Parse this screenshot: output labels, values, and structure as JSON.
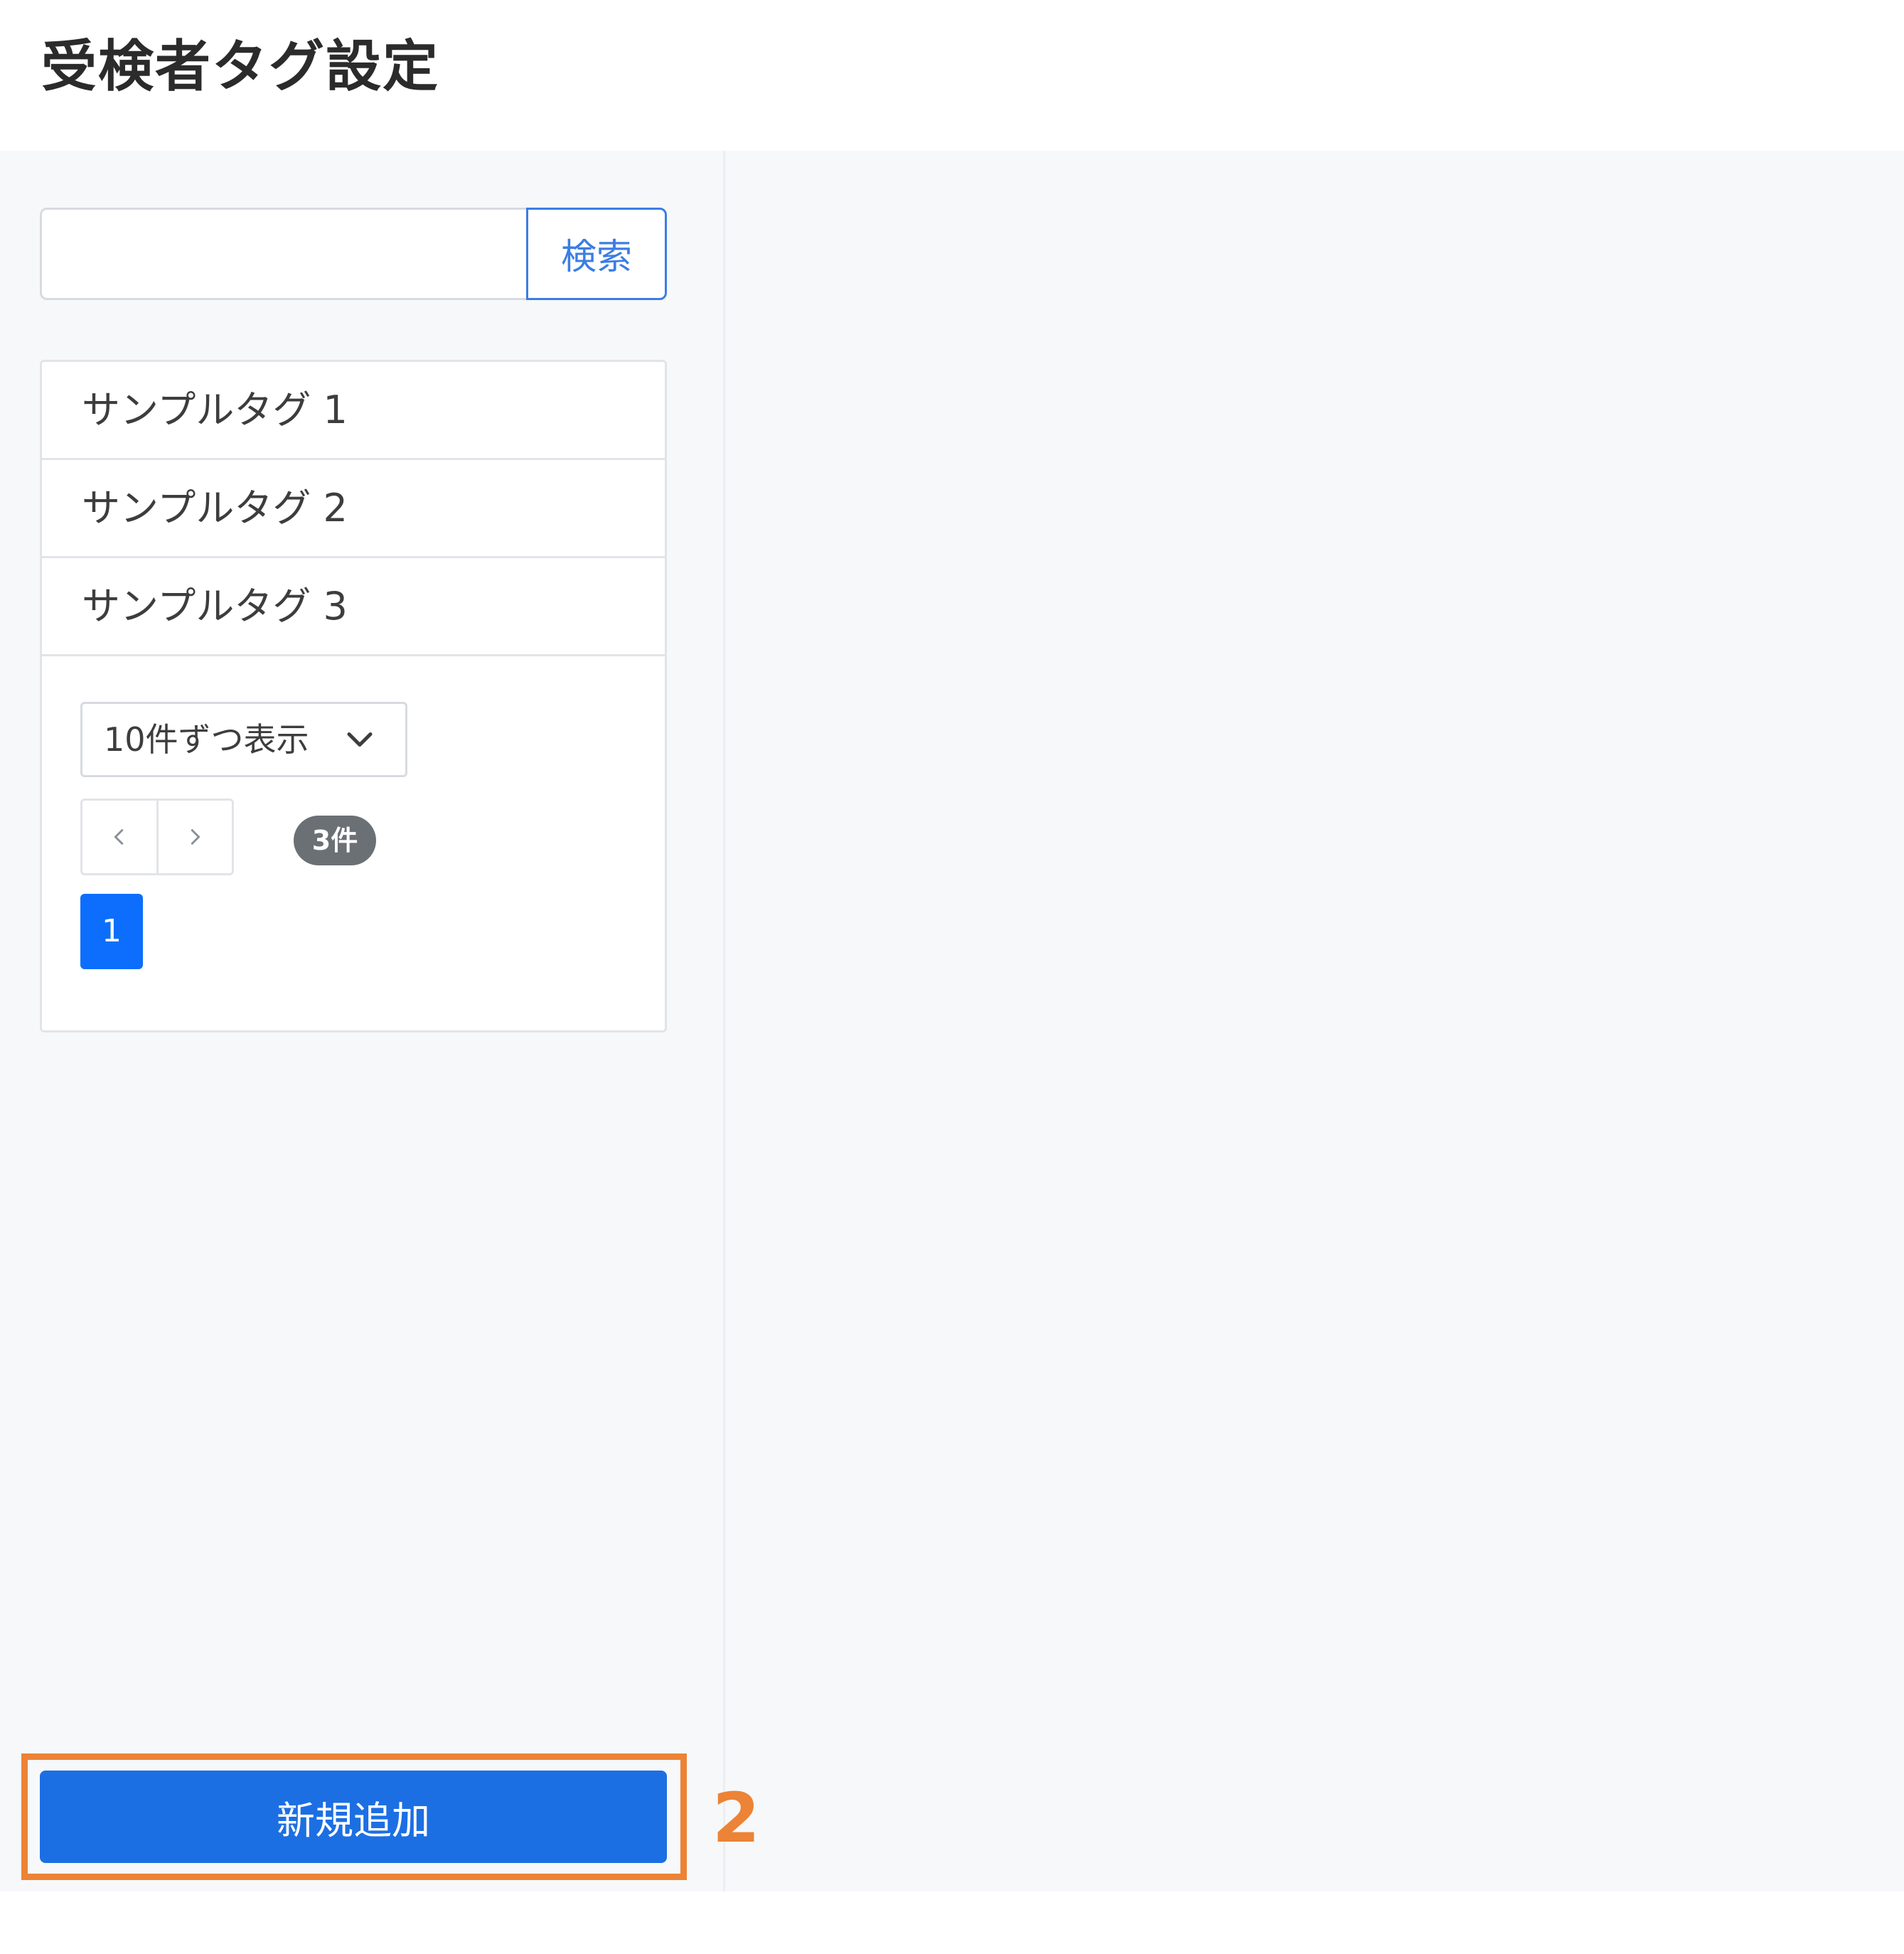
{
  "header": {
    "title": "受検者タグ設定"
  },
  "search": {
    "value": "",
    "placeholder": "",
    "button_label": "検索"
  },
  "tags": {
    "items": [
      {
        "label": "サンプルタグ 1"
      },
      {
        "label": "サンプルタグ 2"
      },
      {
        "label": "サンプルタグ 3"
      }
    ]
  },
  "pagination": {
    "per_page_label": "10件ずつ表示",
    "total_count": "3件",
    "current_page": "1",
    "prev_icon": "chevron-left-icon",
    "next_icon": "chevron-right-icon"
  },
  "actions": {
    "add_label": "新規追加"
  },
  "annotation": {
    "callout_number": "2",
    "callout_color": "#ec8336"
  },
  "colors": {
    "primary": "#1c6fe3",
    "page_active": "#0d6efd",
    "badge": "#6b7075",
    "background": "#f7f8fa"
  }
}
